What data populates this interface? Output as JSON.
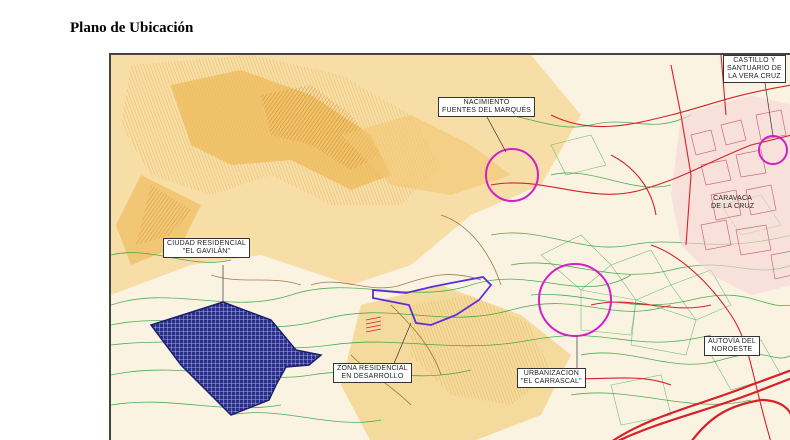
{
  "page": {
    "title": "Plano de Ubicación"
  },
  "map": {
    "colors": {
      "terrain_dark": "#d98f1f",
      "terrain_mid": "#eeb95a",
      "terrain_light": "#f6dca0",
      "contour_green": "#2f9e3a",
      "road_red": "#d8202a",
      "urban_pink": "#c96b7a",
      "gavilan_fill": "#2a2f8c",
      "desarrollo_outline": "#5a2fd6",
      "highlight_circle": "#d21fc9"
    },
    "labels": [
      {
        "id": "ciudad-gavilan",
        "lines": [
          "CIUDAD RESIDENCIAL",
          "\"EL GAVILÁN\""
        ]
      },
      {
        "id": "nacimiento",
        "lines": [
          "NACIMIENTO",
          "FUENTES DEL MARQUÉS"
        ]
      },
      {
        "id": "castillo",
        "lines": [
          "CASTILLO Y",
          "SANTUARIO DE",
          "LA VERA CRUZ"
        ]
      },
      {
        "id": "caravaca",
        "lines": [
          "CARAVACA",
          "DE LA CRUZ"
        ]
      },
      {
        "id": "zona-residencial",
        "lines": [
          "ZONA RESIDENCIAL",
          "EN DESARROLLO"
        ]
      },
      {
        "id": "urbanizacion",
        "lines": [
          "URBANIZACIÓN",
          "\"EL CARRASCAL\""
        ]
      },
      {
        "id": "autovia",
        "lines": [
          "AUTOVÍA DEL",
          "NOROESTE"
        ]
      }
    ]
  }
}
